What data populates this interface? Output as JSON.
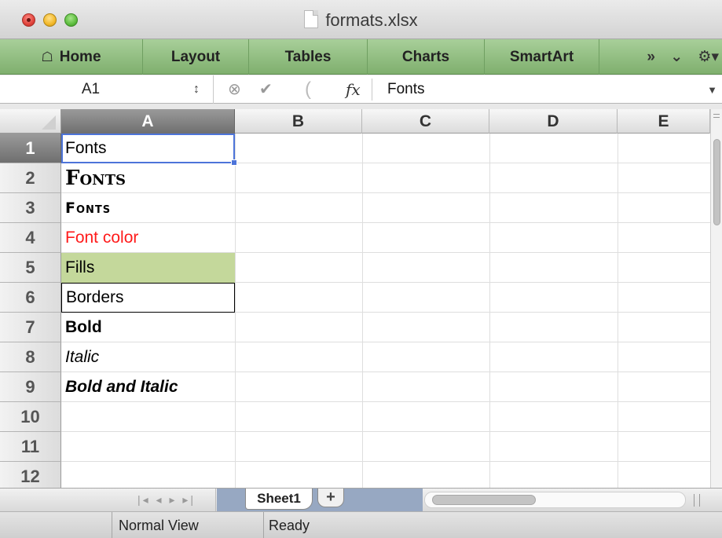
{
  "window": {
    "title": "formats.xlsx"
  },
  "ribbon": {
    "tabs": [
      {
        "label": "Home",
        "icon": "home-icon"
      },
      {
        "label": "Layout"
      },
      {
        "label": "Tables"
      },
      {
        "label": "Charts"
      },
      {
        "label": "SmartArt"
      }
    ],
    "tools": {
      "overflow": "»",
      "collapse": "⌄",
      "settings": "⚙▾"
    }
  },
  "formula_bar": {
    "name_box": "A1",
    "formula": "Fonts",
    "fx_label": "fx"
  },
  "sheet": {
    "columns": [
      "A",
      "B",
      "C",
      "D",
      "E"
    ],
    "selected_column": "A",
    "selected_row": "1",
    "rows": [
      {
        "num": "1",
        "a": "Fonts"
      },
      {
        "num": "2",
        "a": "Fonts"
      },
      {
        "num": "3",
        "a": "Fonts"
      },
      {
        "num": "4",
        "a": "Font color"
      },
      {
        "num": "5",
        "a": "Fills"
      },
      {
        "num": "6",
        "a": "Borders"
      },
      {
        "num": "7",
        "a": "Bold"
      },
      {
        "num": "8",
        "a": "Italic"
      },
      {
        "num": "9",
        "a": "Bold and Italic"
      },
      {
        "num": "10",
        "a": ""
      },
      {
        "num": "11",
        "a": ""
      },
      {
        "num": "12",
        "a": ""
      }
    ],
    "colors": {
      "font_color_red": "#ff1a1a",
      "fill_green": "#c4d89b",
      "selection_blue": "#4d74d9",
      "ribbon_green": "#8fbf7d"
    }
  },
  "sheet_tabs": {
    "nav_arrows": "|◂ ◂ ▸ ▸|",
    "tabs": [
      "Sheet1"
    ],
    "add_label": "+"
  },
  "status": {
    "view": "Normal View",
    "state": "Ready"
  }
}
